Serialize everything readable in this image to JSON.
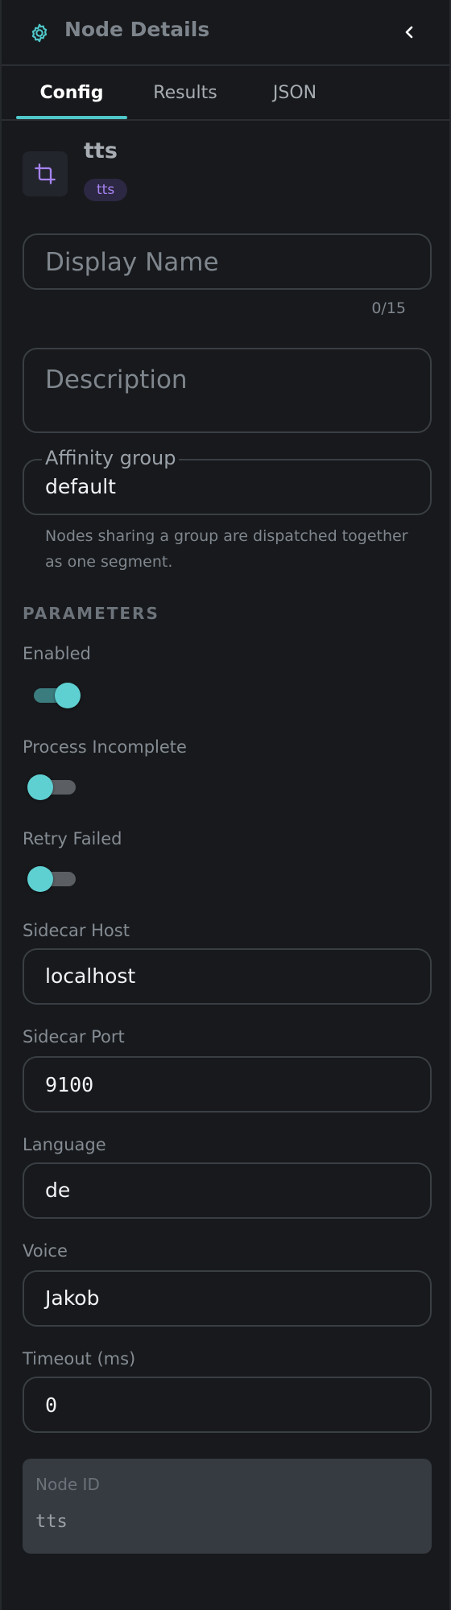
{
  "header": {
    "title": "Node Details"
  },
  "tabs": [
    {
      "label": "Config",
      "active": true
    },
    {
      "label": "Results",
      "active": false
    },
    {
      "label": "JSON",
      "active": false
    }
  ],
  "node": {
    "name": "tts",
    "badge": "tts"
  },
  "display_name": {
    "placeholder": "Display Name",
    "counter": "0/15"
  },
  "description": {
    "placeholder": "Description"
  },
  "affinity_group": {
    "label": "Affinity group",
    "value": "default",
    "helper": "Nodes sharing a group are dispatched together as one segment."
  },
  "parameters": {
    "title": "PARAMETERS",
    "enabled": {
      "label": "Enabled",
      "on": true
    },
    "process_incomplete": {
      "label": "Process Incomplete",
      "on": false
    },
    "retry_failed": {
      "label": "Retry Failed",
      "on": false
    },
    "sidecar_host": {
      "label": "Sidecar Host",
      "value": "localhost"
    },
    "sidecar_port": {
      "label": "Sidecar Port",
      "value": "9100"
    },
    "language": {
      "label": "Language",
      "value": "de"
    },
    "voice": {
      "label": "Voice",
      "value": "Jakob"
    },
    "timeout": {
      "label": "Timeout (ms)",
      "value": "0"
    }
  },
  "node_id": {
    "label": "Node ID",
    "value": "tts"
  },
  "colors": {
    "accent": "#4fc7c9",
    "badge": "#a684f2",
    "background": "#17191c"
  }
}
